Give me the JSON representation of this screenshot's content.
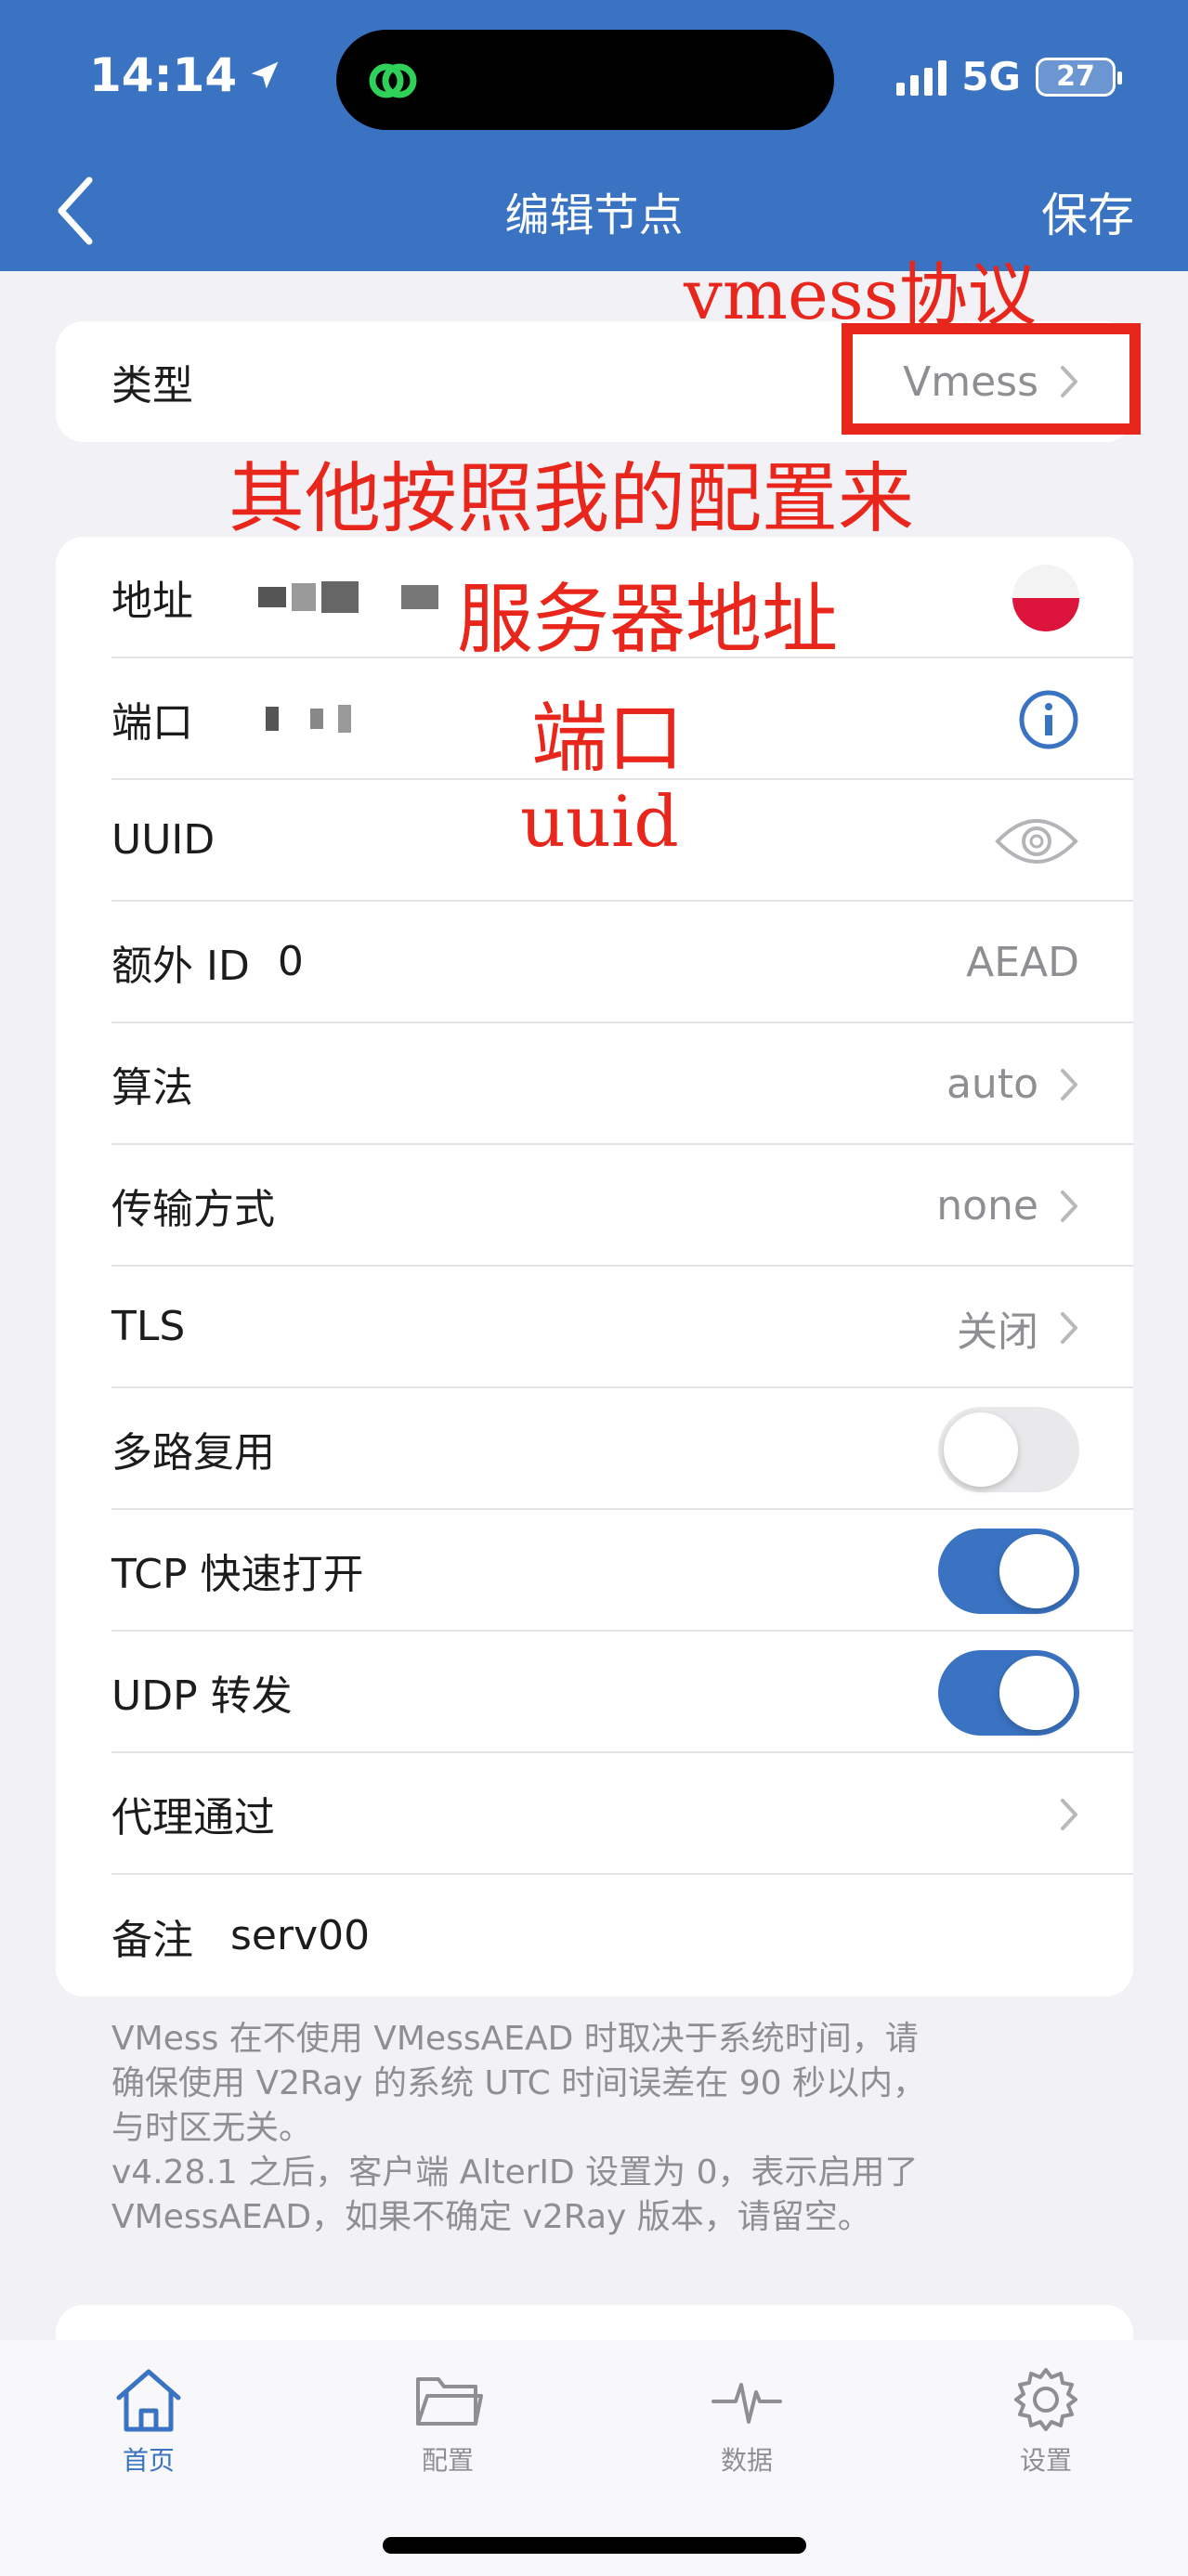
{
  "status_bar": {
    "time": "14:14",
    "network": "5G",
    "battery": "27"
  },
  "nav": {
    "title": "编辑节点",
    "save_label": "保存"
  },
  "type_row": {
    "label": "类型",
    "value": "Vmess"
  },
  "rows": {
    "address": {
      "label": "地址"
    },
    "port": {
      "label": "端口"
    },
    "uuid": {
      "label": "UUID"
    },
    "alter_id": {
      "label": "额外 ID",
      "value": "0",
      "right": "AEAD"
    },
    "algorithm": {
      "label": "算法",
      "right": "auto"
    },
    "transport": {
      "label": "传输方式",
      "right": "none"
    },
    "tls": {
      "label": "TLS",
      "right": "关闭"
    },
    "mux": {
      "label": "多路复用",
      "on": false
    },
    "tcp_fast_open": {
      "label": "TCP 快速打开",
      "on": true
    },
    "udp_forward": {
      "label": "UDP 转发",
      "on": true
    },
    "proxy_via": {
      "label": "代理通过"
    },
    "remark": {
      "label": "备注",
      "value": "serv00"
    }
  },
  "footnote": {
    "line1": "VMess 在不使用 VMessAEAD 时取决于系统时间，请",
    "line2": "确保使用 V2Ray 的系统 UTC 时间误差在 90 秒以内，",
    "line3": "与时区无关。",
    "line4": "v4.28.1 之后，客户端 AlterID 设置为 0，表示启用了",
    "line5": "VMessAEAD，如果不确定 v2Ray 版本，请留空。"
  },
  "annotations": {
    "protocol": "vmess协议",
    "others": "其他按照我的配置来",
    "server_address": "服务器地址",
    "port": "端口",
    "uuid": "uuid"
  },
  "tabbar": [
    {
      "label": "首页",
      "icon": "home-icon",
      "active": true
    },
    {
      "label": "配置",
      "icon": "folder-icon",
      "active": false
    },
    {
      "label": "数据",
      "icon": "pulse-icon",
      "active": false
    },
    {
      "label": "设置",
      "icon": "gear-icon",
      "active": false
    }
  ],
  "colors": {
    "accent": "#3a73c2",
    "annotation": "#e8261c",
    "background": "#f2f2f6"
  }
}
